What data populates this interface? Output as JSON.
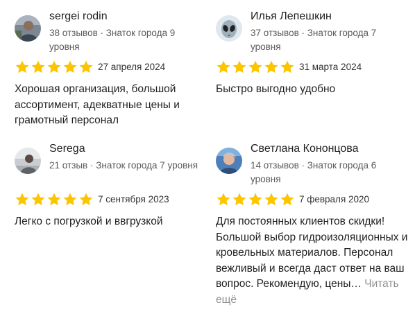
{
  "colors": {
    "star": "#fcc500",
    "text": "#1f1f1f",
    "muted": "#5a5a5a",
    "link": "#8f8f8f"
  },
  "reviews": [
    {
      "author": "sergei rodin",
      "meta": "38 отзывов · Знаток города 9 уровня",
      "rating": 5,
      "date": "27 апреля 2024",
      "text": "Хорошая организация, большой ассортимент, адекватные цены и грамотный персонал",
      "avatar_icon": "photo-avatar"
    },
    {
      "author": "Илья Лепешкин",
      "meta": "37 отзывов · Знаток города 7 уровня",
      "rating": 5,
      "date": "31 марта 2024",
      "text": "Быстро выгодно удобно",
      "avatar_icon": "alien-avatar"
    },
    {
      "author": "Serega",
      "meta": "21 отзыв · Знаток города 7 уровня",
      "rating": 5,
      "date": "7 сентября 2023",
      "text": "Легко с погрузкой и ввгрузкой",
      "avatar_icon": "photo-avatar"
    },
    {
      "author": "Светлана Конoнцова",
      "meta": "14 отзывов · Знаток города 6 уровня",
      "rating": 5,
      "date": "7 февраля 2020",
      "text": "Для постоянных клиентов скидки! Большой выбор гидроизоляционных и кровельных материалов. Персонал вежливый и всегда даст ответ на ваш вопрос. Рекомендую, цены…",
      "read_more": "Читать ещё",
      "avatar_icon": "photo-avatar"
    }
  ]
}
